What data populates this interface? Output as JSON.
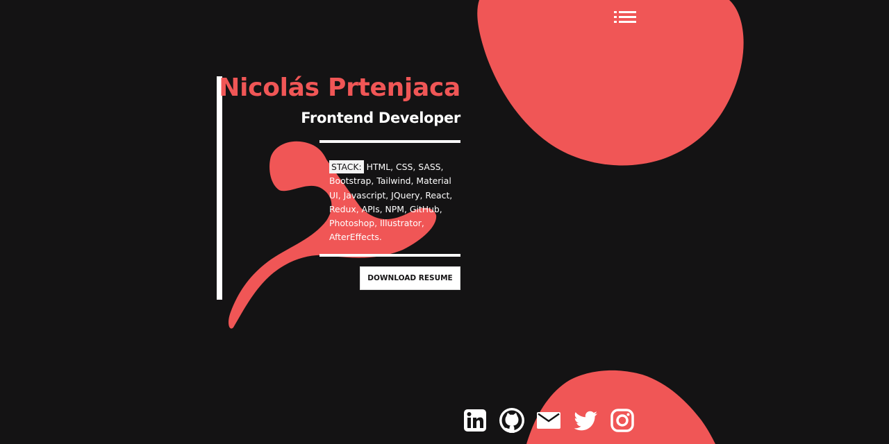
{
  "header": {
    "menu_icon": "list-icon"
  },
  "hero": {
    "name": "Nicolás Prtenjaca",
    "role": "Frontend Developer",
    "stack_label": "STACK:",
    "stack_text": " HTML, CSS, SASS, Bootstrap, Tailwind, Material UI, Javascript, JQuery, React, Redux, APIs, NPM, GitHub, Photoshop, Illustrator, AfterEffects.",
    "download_label": "DOWNLOAD RESUME"
  },
  "socials": [
    {
      "icon": "linkedin-icon"
    },
    {
      "icon": "github-icon"
    },
    {
      "icon": "mail-icon"
    },
    {
      "icon": "twitter-icon"
    },
    {
      "icon": "instagram-icon"
    }
  ],
  "colors": {
    "background": "#141314",
    "accent": "#f05656",
    "text": "#ffffff"
  }
}
